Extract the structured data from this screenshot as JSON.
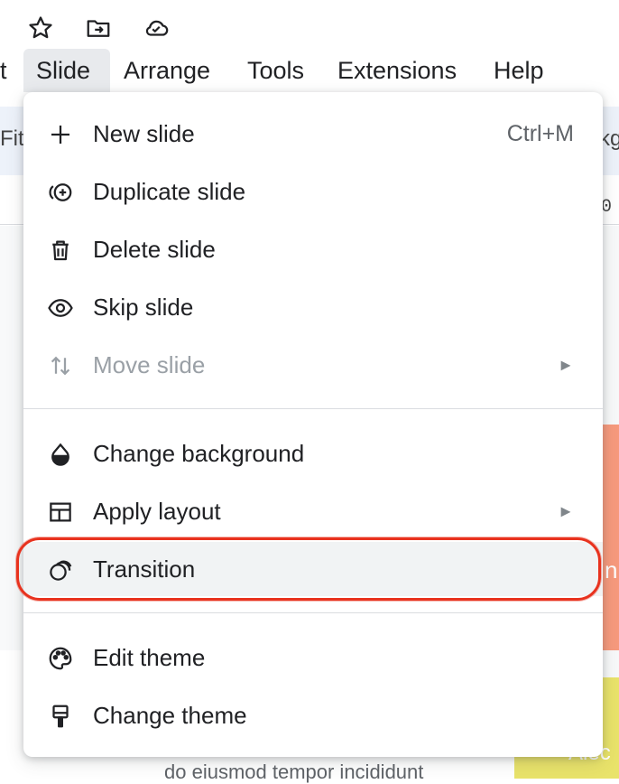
{
  "menubar": {
    "items": [
      {
        "label": "t",
        "active": false
      },
      {
        "label": "Slide",
        "active": true
      },
      {
        "label": "Arrange",
        "active": false
      },
      {
        "label": "Tools",
        "active": false
      },
      {
        "label": "Extensions",
        "active": false
      },
      {
        "label": "Help",
        "active": false
      }
    ]
  },
  "toolbar": {
    "left_fragment": "Fit",
    "right_fragment": "kg",
    "ruler_mark": "0"
  },
  "background": {
    "slide_text_fragment": "n",
    "slide_bottom_fragment": "Aiec",
    "body_text": "do eiusmod tempor incididunt"
  },
  "menu": {
    "items": [
      {
        "label": "New slide",
        "shortcut": "Ctrl+M",
        "icon": "plus-icon",
        "disabled": false
      },
      {
        "label": "Duplicate slide",
        "shortcut": "",
        "icon": "duplicate-icon",
        "disabled": false
      },
      {
        "label": "Delete slide",
        "shortcut": "",
        "icon": "trash-icon",
        "disabled": false
      },
      {
        "label": "Skip slide",
        "shortcut": "",
        "icon": "eye-icon",
        "disabled": false
      },
      {
        "label": "Move slide",
        "shortcut": "",
        "icon": "move-icon",
        "disabled": true,
        "submenu": true
      },
      {
        "label": "Change background",
        "shortcut": "",
        "icon": "drop-icon",
        "disabled": false
      },
      {
        "label": "Apply layout",
        "shortcut": "",
        "icon": "layout-icon",
        "disabled": false,
        "submenu": true
      },
      {
        "label": "Transition",
        "shortcut": "",
        "icon": "transition-icon",
        "disabled": false,
        "highlighted": true
      },
      {
        "label": "Edit theme",
        "shortcut": "",
        "icon": "palette-icon",
        "disabled": false
      },
      {
        "label": "Change theme",
        "shortcut": "",
        "icon": "paint-roller-icon",
        "disabled": false
      }
    ],
    "submenu_arrow": "►"
  },
  "colors": {
    "annotation": "#e8321e",
    "menu_hover": "#f1f3f4",
    "disabled_text": "#9aa0a6"
  }
}
